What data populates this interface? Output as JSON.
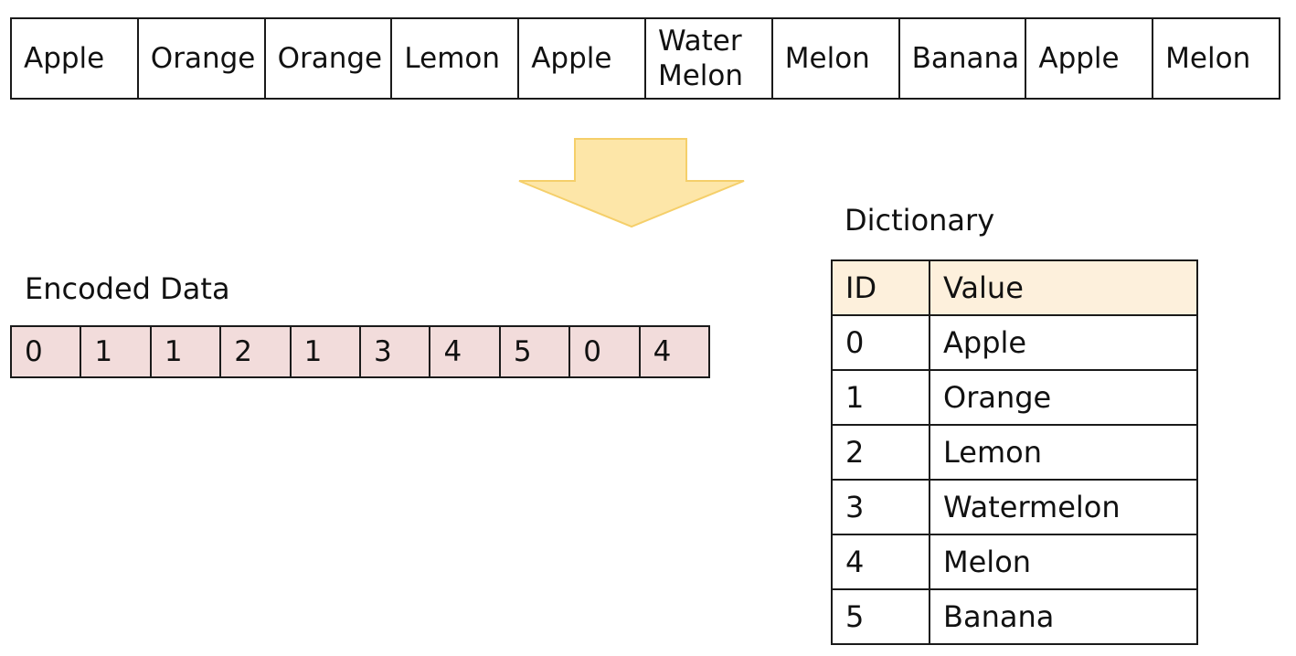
{
  "raw_data": {
    "cells": [
      "Apple",
      "Orange",
      "Orange",
      "Lemon",
      "Apple",
      "Water\nMelon",
      "Melon",
      "Banana",
      "Apple",
      "Melon"
    ]
  },
  "arrow": {
    "fill": "#fde6a8",
    "stroke": "#f5cf6a"
  },
  "encoded": {
    "label": "Encoded Data",
    "values": [
      "0",
      "1",
      "1",
      "2",
      "1",
      "3",
      "4",
      "5",
      "0",
      "4"
    ],
    "fill": "#f2dcdb"
  },
  "dictionary": {
    "label": "Dictionary",
    "headers": {
      "id": "ID",
      "value": "Value"
    },
    "header_fill": "#fdf0dc",
    "rows": [
      {
        "id": "0",
        "value": "Apple"
      },
      {
        "id": "1",
        "value": "Orange"
      },
      {
        "id": "2",
        "value": "Lemon"
      },
      {
        "id": "3",
        "value": "Watermelon"
      },
      {
        "id": "4",
        "value": "Melon"
      },
      {
        "id": "5",
        "value": "Banana"
      }
    ]
  }
}
